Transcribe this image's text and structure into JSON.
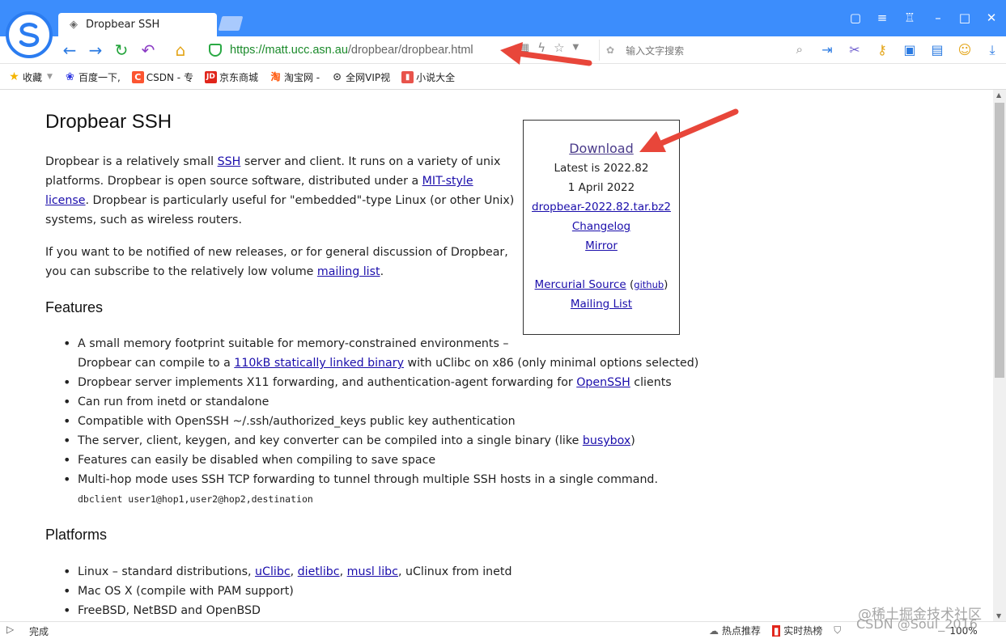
{
  "browser": {
    "tab_title": "Dropbear SSH",
    "url_host": "https://matt.ucc.asn.au",
    "url_path": "/dropbear/dropbear.html",
    "search_placeholder": "输入文字搜索",
    "bookmarks": [
      {
        "label": "收藏",
        "icon": "star-icon",
        "color": "#f4b400"
      },
      {
        "label": "百度一下,",
        "icon": "baidu-icon",
        "color": "#2932e1"
      },
      {
        "label": "CSDN - 专",
        "icon": "csdn-icon",
        "color": "#fc5531"
      },
      {
        "label": "京东商城",
        "icon": "jd-icon",
        "color": "#e1251b"
      },
      {
        "label": "淘宝网 -",
        "icon": "taobao-icon",
        "color": "#ff5000"
      },
      {
        "label": "全网VIP视",
        "icon": "play-icon",
        "color": "#444444"
      },
      {
        "label": "小说大全",
        "icon": "book-icon",
        "color": "#e8534b"
      }
    ],
    "status_text": "完成",
    "status_hot": "热点推荐",
    "status_realtime": "实时热榜",
    "zoom": "100%"
  },
  "page": {
    "title": "Dropbear SSH",
    "intro_1": "Dropbear is a relatively small ",
    "intro_ssh": "SSH",
    "intro_2": " server and client. It runs on a variety of unix platforms. Dropbear is open source software, distributed under a ",
    "intro_license": "MIT-style license",
    "intro_3": ". Dropbear is particularly useful for \"embedded\"-type Linux (or other Unix) systems, such as wireless routers.",
    "notify_1": "If you want to be notified of new releases, or for general discussion of Dropbear, you can subscribe to the relatively low volume ",
    "notify_link": "mailing list",
    "notify_2": ".",
    "features_heading": "Features",
    "features": {
      "f1a": "A small memory footprint suitable for memory-constrained environments –",
      "f1b_pre": "Dropbear can compile to a ",
      "f1b_link": "110kB statically linked binary",
      "f1b_post": " with uClibc on x86 (only minimal options selected)",
      "f2_pre": "Dropbear server implements X11 forwarding, and authentication-agent forwarding for ",
      "f2_link": "OpenSSH",
      "f2_post": " clients",
      "f3": "Can run from inetd or standalone",
      "f4": "Compatible with OpenSSH ~/.ssh/authorized_keys public key authentication",
      "f5_pre": "The server, client, keygen, and key converter can be compiled into a single binary (like ",
      "f5_link": "busybox",
      "f5_post": ")",
      "f6": "Features can easily be disabled when compiling to save space",
      "f7": "Multi-hop mode uses SSH TCP forwarding to tunnel through multiple SSH hosts in a single command.",
      "f7_code": "dbclient  user1@hop1,user2@hop2,destination"
    },
    "platforms_heading": "Platforms",
    "platforms": {
      "p1_pre": "Linux – standard distributions, ",
      "p1_l1": "uClibc",
      "p1_l2": "dietlibc",
      "p1_l3": "musl libc",
      "p1_post": ", uClinux from inetd",
      "sep": ", ",
      "p2": "Mac OS X (compile with PAM support)",
      "p3": "FreeBSD, NetBSD and OpenBSD"
    },
    "sidebox": {
      "download": "Download",
      "latest": "Latest is 2022.82",
      "date": "1 April 2022",
      "tarball": "dropbear-2022.82.tar.bz2",
      "changelog": "Changelog",
      "mirror": "Mirror",
      "mercurial": "Mercurial Source",
      "github_open": " (",
      "github": "github",
      "github_close": ")",
      "mailing": "Mailing List"
    }
  },
  "annotation_color": "#e8463a",
  "watermark": "@稀土掘金技术社区",
  "watermark2": "CSDN @Soul_2016"
}
